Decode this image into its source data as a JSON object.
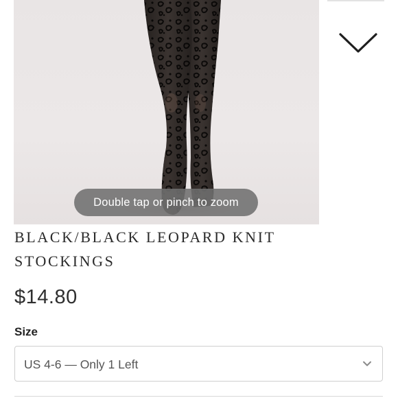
{
  "product": {
    "image_overlay_hint": "Double tap or pinch to zoom",
    "title": "BLACK/BLACK LEOPARD KNIT STOCKINGS",
    "price": "$14.80"
  },
  "size_selector": {
    "label": "Size",
    "selected_value": "US 4-6 — Only 1 Left"
  },
  "icons": {
    "next_image": "chevron-down-icon",
    "select_arrow": "chevron-down-icon"
  },
  "colors": {
    "image_background": "#e9e5e5",
    "zoom_hint_background": "#707070",
    "text_dark": "#222222",
    "select_border": "#cfcfcf"
  }
}
